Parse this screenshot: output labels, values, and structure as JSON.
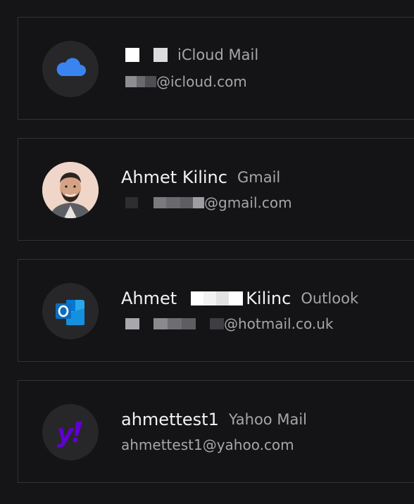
{
  "accounts": [
    {
      "provider": "iCloud Mail",
      "name": "",
      "email_suffix": "@icloud.com",
      "icon": "cloud-icon",
      "accent": "#3a84f2"
    },
    {
      "provider": "Gmail",
      "name": "Ahmet Kilinc",
      "email_suffix": "@gmail.com",
      "icon": "profile-photo"
    },
    {
      "provider": "Outlook",
      "name_first": "Ahmet",
      "name_last": "Kilinc",
      "email_suffix": "@hotmail.co.uk",
      "icon": "outlook-icon",
      "accent": "#0f6cbd"
    },
    {
      "provider": "Yahoo Mail",
      "name": "ahmettest1",
      "email": "ahmettest1@yahoo.com",
      "icon": "yahoo-icon",
      "accent": "#6001d2"
    }
  ]
}
